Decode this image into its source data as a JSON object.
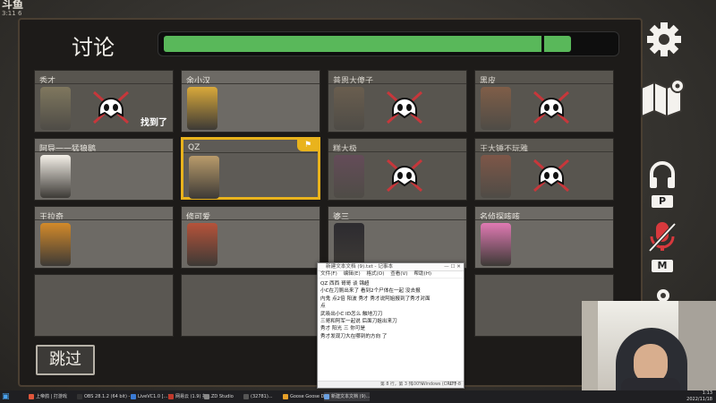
{
  "brand": {
    "logo_text": "斗鱼",
    "room_id": "3:11 6"
  },
  "header": {
    "title": "讨论",
    "timer_fraction": 0.91
  },
  "players": [
    {
      "name": "秀才",
      "dead": true,
      "found_label": "找到了",
      "avatar_color": "#c8b77a"
    },
    {
      "name": "余小汉",
      "dead": false,
      "avatar_color": "#d9a93a"
    },
    {
      "name": "普恩大傻子",
      "dead": true,
      "avatar_color": "#8a6e4e"
    },
    {
      "name": "黑皮",
      "dead": true,
      "avatar_color": "#c86e3a"
    },
    {
      "name": "阿导一一猛狼鹅",
      "dead": false,
      "avatar_color": "#f4f0e8"
    },
    {
      "name": "QZ",
      "dead": false,
      "active": true,
      "avatar_color": "#b99b6b"
    },
    {
      "name": "糕大极",
      "dead": true,
      "avatar_color": "#7b3b6a"
    },
    {
      "name": "王大锤不玩雅",
      "dead": true,
      "avatar_color": "#c25a3a"
    },
    {
      "name": "王拉奇",
      "dead": false,
      "avatar_color": "#d38a2a"
    },
    {
      "name": "修可爱",
      "dead": false,
      "avatar_color": "#b6533a"
    },
    {
      "name": "婆三",
      "dead": false,
      "avatar_color": "#2d2b30"
    },
    {
      "name": "名侦探咳咳",
      "dead": false,
      "avatar_color": "#e07ab3"
    }
  ],
  "skip_label": "跳过",
  "side_icons": {
    "settings": "gear-icon",
    "map": "map-icon",
    "voice_key": "P",
    "mute_key": "M"
  },
  "notepad": {
    "title": "新建文本文档 (9).txt - 记事本",
    "menu": [
      "文件(F)",
      "编辑(E)",
      "格式(O)",
      "查看(V)",
      "帮助(H)"
    ],
    "lines": [
      "QZ 西西 哥哥 谈 锦超",
      "小C在刀厕出来了 看到2个尸体在一起 没去报",
      "内鬼 点2倍 阳波 秀才 秀才说阿姐报到了秀才对面",
      "点",
      "武吸出小C ID怎么 触地刀刀",
      "三哥和阿军一起说 后面刀姐出来刀",
      "秀才 阳光 三 你可是",
      "秀才发现刀大在哪到的方向 了"
    ],
    "status": {
      "position": "第 8 行，第 3 列",
      "zoom": "100%",
      "eol": "Windows (CRLF)",
      "encoding": "UTF-8"
    }
  },
  "taskbar": {
    "items": [
      "上帝鸽 | 打游戏",
      "OBS 28.1.2 (64 bit) -",
      "LiveVC1.0 [...]",
      "网易云 (1.9) 打...",
      "ZD Studio",
      "(32781)...",
      "Goose Goose Duc...",
      "新建文本文档 (9)..."
    ],
    "clock_time": "1:13",
    "clock_date": "2022/11/18"
  },
  "colors": {
    "accent": "#e9b31c",
    "timer": "#59b85a",
    "cross": "#c7373b"
  }
}
